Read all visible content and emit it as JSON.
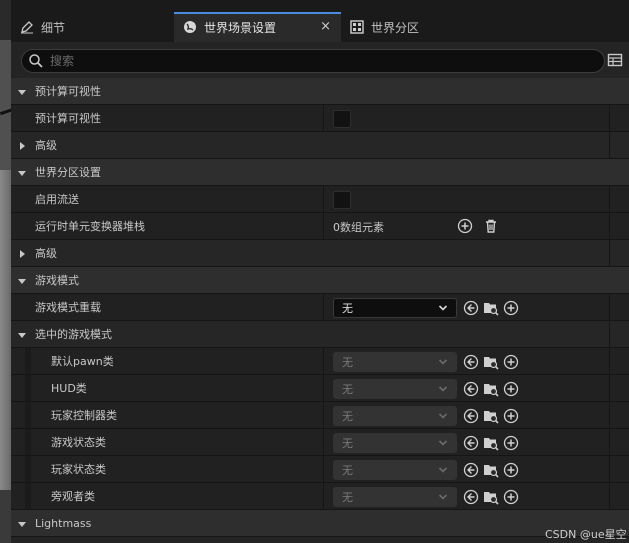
{
  "tabs": [
    {
      "label": "细节",
      "icon": "pencil-icon",
      "active": false
    },
    {
      "label": "世界场景设置",
      "icon": "globe-icon",
      "active": true,
      "close": "×"
    },
    {
      "label": "世界分区",
      "icon": "grid-icon",
      "active": false
    }
  ],
  "search": {
    "placeholder": "搜索"
  },
  "rows": [
    {
      "kind": "cat",
      "label": "预计算可视性"
    },
    {
      "kind": "prop",
      "label": "预计算可视性",
      "control": "checkbox"
    },
    {
      "kind": "sub",
      "label": "高级",
      "collapsed": true
    },
    {
      "kind": "cat",
      "label": "世界分区设置"
    },
    {
      "kind": "prop",
      "label": "启用流送",
      "control": "checkbox"
    },
    {
      "kind": "prop",
      "label": "运行时单元变换器堆栈",
      "control": "array",
      "value": "0数组元素"
    },
    {
      "kind": "sub",
      "label": "高级",
      "collapsed": true
    },
    {
      "kind": "cat",
      "label": "游戏模式"
    },
    {
      "kind": "prop",
      "label": "游戏模式重载",
      "control": "combo",
      "value": "无"
    },
    {
      "kind": "sub",
      "label": "选中的游戏模式"
    },
    {
      "kind": "nested",
      "label": "默认pawn类",
      "control": "combo-disabled",
      "value": "无"
    },
    {
      "kind": "nested",
      "label": "HUD类",
      "control": "combo-disabled",
      "value": "无"
    },
    {
      "kind": "nested",
      "label": "玩家控制器类",
      "control": "combo-disabled",
      "value": "无"
    },
    {
      "kind": "nested",
      "label": "游戏状态类",
      "control": "combo-disabled",
      "value": "无"
    },
    {
      "kind": "nested",
      "label": "玩家状态类",
      "control": "combo-disabled",
      "value": "无"
    },
    {
      "kind": "nested",
      "label": "旁观者类",
      "control": "combo-disabled",
      "value": "无"
    },
    {
      "kind": "cat",
      "label": "Lightmass"
    }
  ],
  "watermark": "CSDN @ue星空",
  "colors": {
    "accent": "#4a8de0",
    "panel": "#242424",
    "category": "#2e2e2e"
  }
}
